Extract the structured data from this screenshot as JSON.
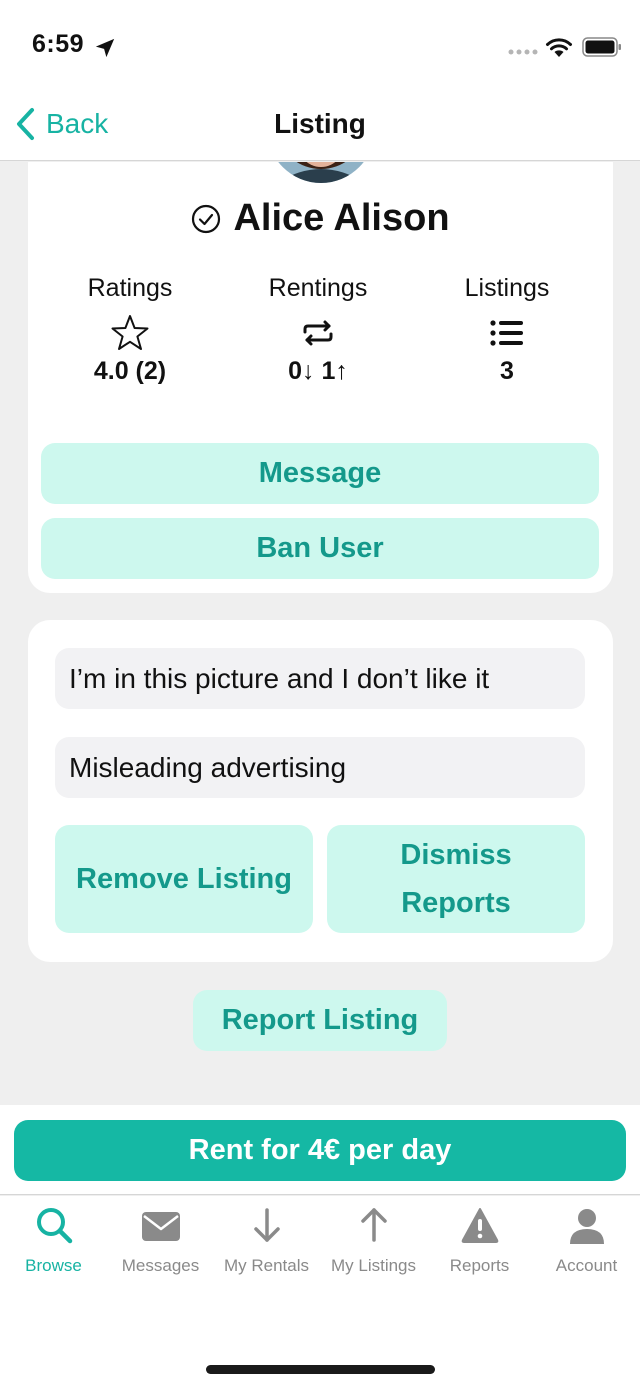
{
  "status_bar": {
    "time": "6:59"
  },
  "nav": {
    "back_label": "Back",
    "title": "Listing"
  },
  "profile": {
    "name": "Alice Alison",
    "stats": [
      {
        "label": "Ratings",
        "icon": "star-icon",
        "value": "4.0 (2)"
      },
      {
        "label": "Rentings",
        "icon": "repeat-icon",
        "value": "0↓ 1↑"
      },
      {
        "label": "Listings",
        "icon": "list-icon",
        "value": "3"
      }
    ],
    "message_label": "Message",
    "ban_label": "Ban User"
  },
  "reports": {
    "reasons": [
      "I’m in this picture and I don’t like it",
      "Misleading advertising"
    ],
    "remove_label": "Remove Listing",
    "dismiss_label_line1": "Dismiss",
    "dismiss_label_line2": "Reports"
  },
  "report_listing_label": "Report Listing",
  "rent_label": "Rent for 4€ per day",
  "tabs": [
    {
      "label": "Browse",
      "icon": "search-icon",
      "active": true
    },
    {
      "label": "Messages",
      "icon": "envelope-icon",
      "active": false
    },
    {
      "label": "My Rentals",
      "icon": "arrow-down-icon",
      "active": false
    },
    {
      "label": "My Listings",
      "icon": "arrow-up-icon",
      "active": false
    },
    {
      "label": "Reports",
      "icon": "warning-icon",
      "active": false
    },
    {
      "label": "Account",
      "icon": "person-icon",
      "active": false
    }
  ],
  "colors": {
    "accent": "#17b3a3",
    "button_bg": "#cdf8ee",
    "button_text": "#14998b",
    "rent_button": "#15b8a4",
    "inactive_tab": "#8a8a8a"
  }
}
